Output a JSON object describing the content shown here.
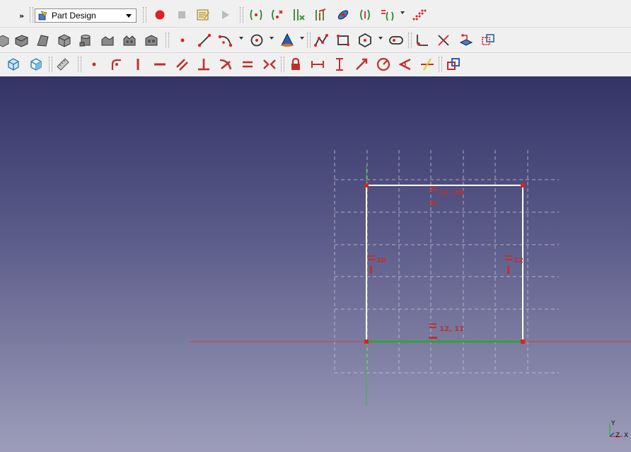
{
  "toolbar": {
    "overflow_label": "»",
    "workbench": {
      "selected": "Part Design"
    }
  },
  "sketch": {
    "constraint_labels": {
      "top": "11, 10",
      "left": "10",
      "right": "12",
      "bottom": "12, 11"
    }
  },
  "axis_cross": {
    "y": "Y",
    "z": "Z",
    "x": "X"
  },
  "colors": {
    "constraint": "#c0302a",
    "vertex": "#e02020",
    "fixed_edge": "#22aa22",
    "edge": "#ffffff",
    "x_axis": "#d04040",
    "y_axis": "#33bb33"
  }
}
